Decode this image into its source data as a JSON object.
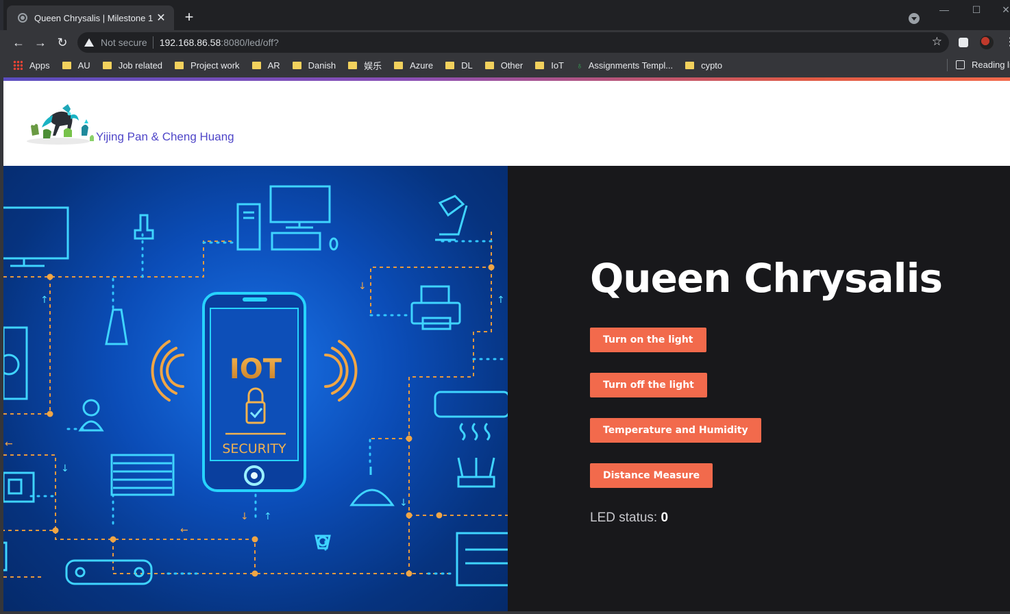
{
  "browser": {
    "tab_title": "Queen Chrysalis | Milestone 1",
    "tab_close": "✕",
    "new_tab": "+",
    "window_controls": {
      "minimize": "—",
      "maximize": "☐",
      "close": "✕"
    },
    "nav": {
      "back": "←",
      "forward": "→",
      "reload": "↻"
    },
    "address": {
      "security": "Not secure",
      "host": "192.168.86.58",
      "path": ":8080/led/off?"
    },
    "star": "☆",
    "menu": "⋮",
    "bookmarks": [
      {
        "label": "Apps",
        "icon": "apps-grid-icon"
      },
      {
        "label": "AU",
        "icon": "folder-icon"
      },
      {
        "label": "Job related",
        "icon": "folder-icon"
      },
      {
        "label": "Project work",
        "icon": "folder-icon"
      },
      {
        "label": "AR",
        "icon": "folder-icon"
      },
      {
        "label": "Danish",
        "icon": "folder-icon"
      },
      {
        "label": "娱乐",
        "icon": "folder-icon"
      },
      {
        "label": "Azure",
        "icon": "folder-icon"
      },
      {
        "label": "DL",
        "icon": "folder-icon"
      },
      {
        "label": "Other",
        "icon": "folder-icon"
      },
      {
        "label": "IoT",
        "icon": "folder-icon"
      },
      {
        "label": "Assignments Templ...",
        "icon": "leaf-icon"
      },
      {
        "label": "cypto",
        "icon": "folder-icon"
      }
    ],
    "reading_list": "Reading list"
  },
  "site": {
    "brand": "Yijing Pan & Cheng Huang",
    "hero_title": "Queen Chrysalis",
    "hero_image": {
      "title": "IOT",
      "subtitle": "SECURITY"
    },
    "buttons": [
      "Turn on the light",
      "Turn off the light",
      "Temperature and Humidity",
      "Distance Measure"
    ],
    "status_label": "LED status: ",
    "status_value": "0"
  },
  "colors": {
    "accent": "#f26a4c",
    "brand_text": "#4f46c8",
    "hero_bg": "#18181b"
  }
}
